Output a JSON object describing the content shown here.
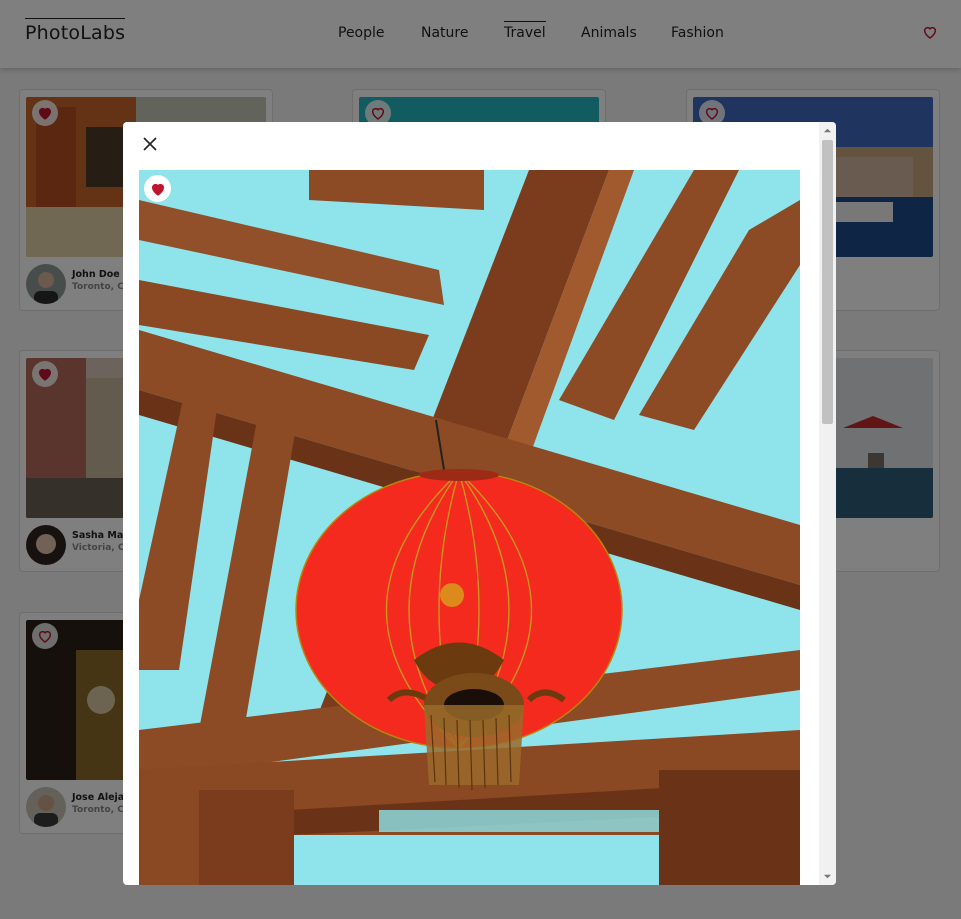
{
  "app": {
    "logo": "PhotoLabs"
  },
  "topics": [
    {
      "label": "People",
      "active": false
    },
    {
      "label": "Nature",
      "active": false
    },
    {
      "label": "Travel",
      "active": true
    },
    {
      "label": "Animals",
      "active": false
    },
    {
      "label": "Fashion",
      "active": false
    }
  ],
  "photos": [
    {
      "user": "John Doe",
      "location": "Toronto, Ca",
      "favourited": true
    },
    {
      "user": "",
      "location": "",
      "favourited": false
    },
    {
      "user": "",
      "location": "",
      "favourited": false
    },
    {
      "user": "Sasha Mate",
      "location": "Victoria, Ca",
      "favourited": true
    },
    {
      "user": "",
      "location": "",
      "favourited": false
    },
    {
      "user": "Jose Alejan",
      "location": "Toronto, Ca",
      "favourited": false
    }
  ],
  "modal": {
    "favourited": true
  },
  "colors": {
    "accent": "#c0152f",
    "sky": "#8fe3ea",
    "lantern": "#f42a1f",
    "wood": "#8c4a25"
  },
  "icons": {
    "close": "close-icon",
    "favourite": "heart-icon"
  }
}
